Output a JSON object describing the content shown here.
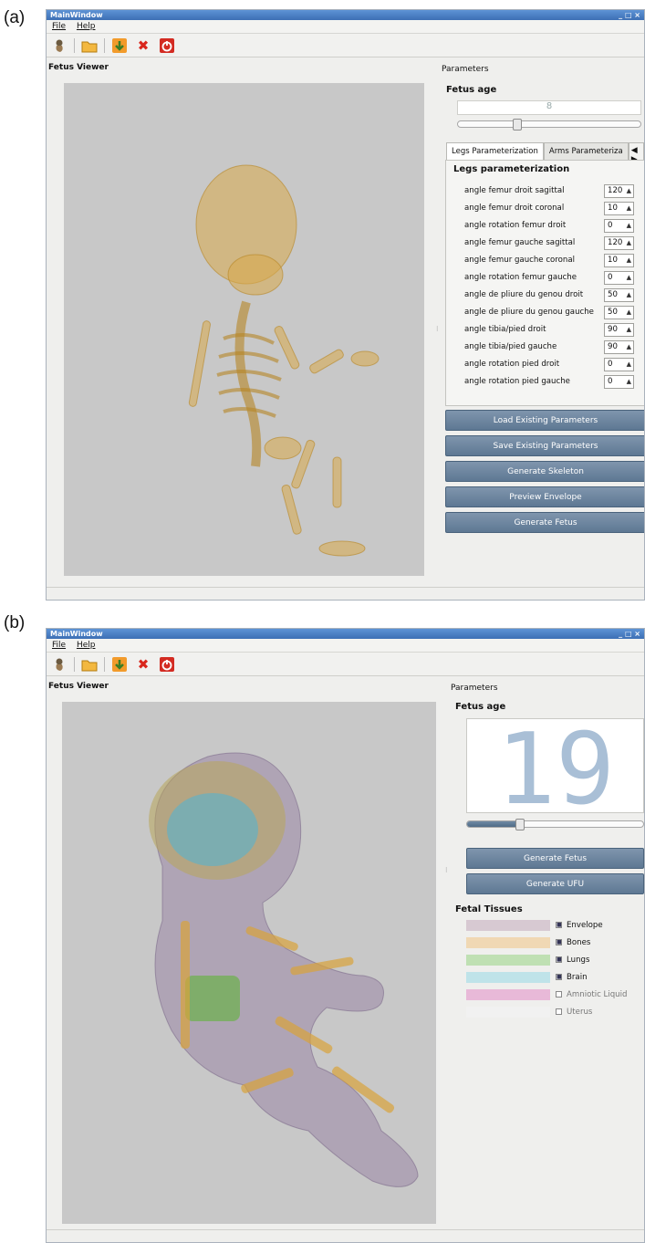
{
  "panel_a": {
    "label": "(a)",
    "window_title": "MainWindow",
    "window_controls": "_ □ ×",
    "menu": [
      "File",
      "Help"
    ],
    "toolbar_icons": [
      "fetus-icon",
      "open-folder-icon",
      "download-icon",
      "close-x-icon",
      "power-icon"
    ],
    "viewer_title": "Fetus Viewer",
    "params_title": "Parameters",
    "fetus_age_label": "Fetus age",
    "fetus_age_value": "8",
    "age_slider_fraction": 0.33,
    "tabs": [
      "Legs Parameterization",
      "Arms Parameteriza"
    ],
    "tab_arrows": "◀ ▶",
    "group_title": "Legs parameterization",
    "params": [
      {
        "label": "angle femur droit sagittal",
        "value": "120"
      },
      {
        "label": "angle femur droit coronal",
        "value": "10"
      },
      {
        "label": "angle rotation femur droit",
        "value": "0"
      },
      {
        "label": "angle femur gauche sagittal",
        "value": "120"
      },
      {
        "label": "angle femur gauche coronal",
        "value": "10"
      },
      {
        "label": "angle rotation femur gauche",
        "value": "0"
      },
      {
        "label": "angle de pliure du genou droit",
        "value": "50"
      },
      {
        "label": "angle de pliure du genou gauche",
        "value": "50"
      },
      {
        "label": "angle tibia/pied droit",
        "value": "90"
      },
      {
        "label": "angle tibia/pied gauche",
        "value": "90"
      },
      {
        "label": "angle rotation pied droit",
        "value": "0"
      },
      {
        "label": "angle rotation pied gauche",
        "value": "0"
      }
    ],
    "buttons": [
      "Load Existing Parameters",
      "Save Existing Parameters",
      "Generate Skeleton",
      "Preview Envelope",
      "Generate Fetus"
    ]
  },
  "panel_b": {
    "label": "(b)",
    "window_title": "MainWindow",
    "window_controls": "_ □ ×",
    "menu": [
      "File",
      "Help"
    ],
    "toolbar_icons": [
      "fetus-icon",
      "open-folder-icon",
      "download-icon",
      "close-x-icon",
      "power-icon"
    ],
    "viewer_title": "Fetus Viewer",
    "params_title": "Parameters",
    "fetus_age_label": "Fetus age",
    "fetus_age_value": "19",
    "age_slider_fraction": 0.3,
    "buttons": [
      "Generate Fetus",
      "Generate UFU"
    ],
    "tissues_title": "Fetal Tissues",
    "tissues": [
      {
        "name": "Envelope",
        "color": "#d7c9d2",
        "checked": true
      },
      {
        "name": "Bones",
        "color": "#f0d8b4",
        "checked": true
      },
      {
        "name": "Lungs",
        "color": "#bfe0b3",
        "checked": true
      },
      {
        "name": "Brain",
        "color": "#bfe3e9",
        "checked": true
      },
      {
        "name": "Amniotic Liquid",
        "color": "#e8b9d8",
        "checked": false
      },
      {
        "name": "Uterus",
        "color": "#f1f1f1",
        "checked": false
      }
    ],
    "lcd_color": "#a9bfd6"
  }
}
